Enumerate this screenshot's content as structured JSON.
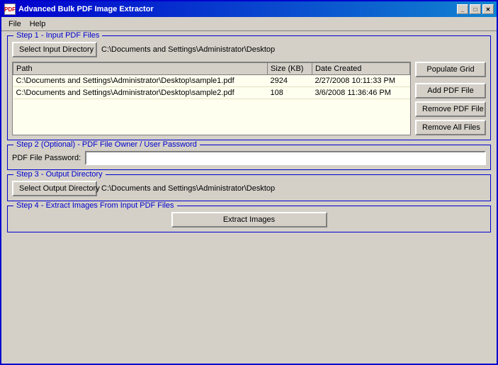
{
  "window": {
    "title": "Advanced Bulk PDF Image Extractor",
    "icon": "pdf"
  },
  "titlebar_buttons": {
    "minimize": "_",
    "maximize": "□",
    "close": "✕"
  },
  "menu": {
    "items": [
      {
        "label": "File"
      },
      {
        "label": "Help"
      }
    ]
  },
  "step1": {
    "legend": "Step 1 - Input PDF Files",
    "select_button": "Select Input Directory",
    "input_path": "C:\\Documents and Settings\\Administrator\\Desktop",
    "table": {
      "columns": [
        "Path",
        "Size (KB)",
        "Date Created"
      ],
      "rows": [
        {
          "path": "C:\\Documents and Settings\\Administrator\\Desktop\\sample1.pdf",
          "size": "2924",
          "date": "2/27/2008 10:11:33 PM"
        },
        {
          "path": "C:\\Documents and Settings\\Administrator\\Desktop\\sample2.pdf",
          "size": "108",
          "date": "3/6/2008 11:36:46 PM"
        }
      ]
    },
    "populate_grid_button": "Populate Grid",
    "add_pdf_button": "Add PDF File",
    "remove_pdf_button": "Remove PDF File",
    "remove_all_button": "Remove All Files"
  },
  "step2": {
    "legend": "Step 2 (Optional) - PDF File Owner / User Password",
    "password_label": "PDF File Password:",
    "password_placeholder": ""
  },
  "step3": {
    "legend": "Step 3 - Output Directory",
    "select_button": "Select Output Directory",
    "output_path": "C:\\Documents and Settings\\Administrator\\Desktop"
  },
  "step4": {
    "legend": "Step 4 - Extract Images From Input PDF Files",
    "extract_button": "Extract Images"
  }
}
